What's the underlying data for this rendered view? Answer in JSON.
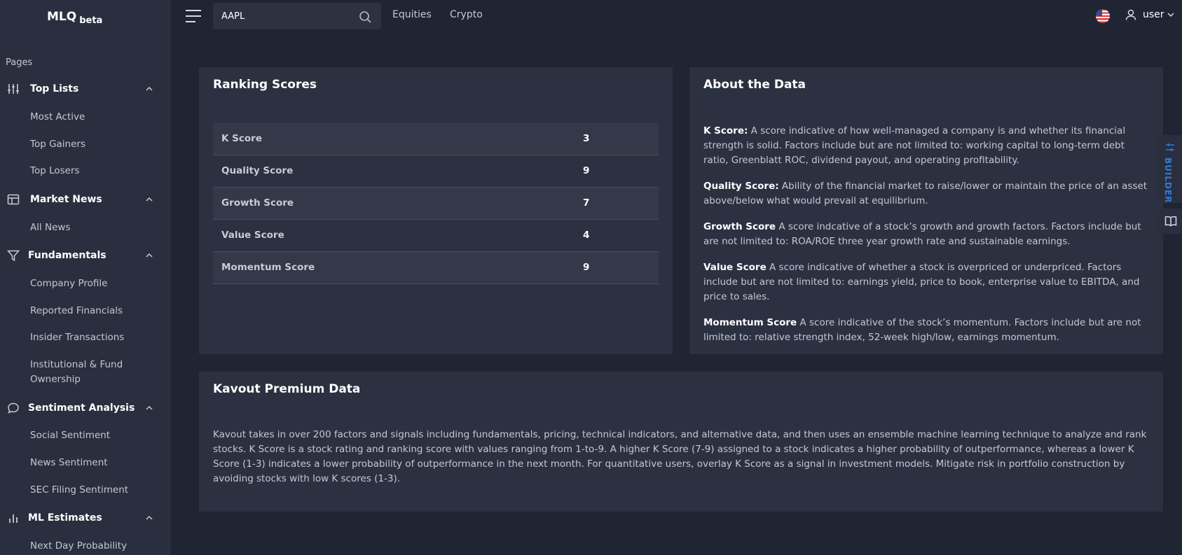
{
  "app": {
    "logo": "MLQ",
    "badge": "beta"
  },
  "sidebar": {
    "pages_label": "Pages",
    "sections": [
      {
        "label": "Top Lists",
        "icon": "sliders-icon",
        "items": [
          "Most Active",
          "Top Gainers",
          "Top Losers"
        ]
      },
      {
        "label": "Market News",
        "icon": "newspaper-icon",
        "items": [
          "All News"
        ]
      },
      {
        "label": "Fundamentals",
        "icon": "filter-icon",
        "items": [
          "Company Profile",
          "Reported Financials",
          "Insider Transactions",
          "Institutional & Fund",
          "Ownership"
        ]
      },
      {
        "label": "Sentiment Analysis",
        "icon": "chat-bubble-icon",
        "items": [
          "Social Sentiment",
          "News Sentiment",
          "SEC Filing Sentiment"
        ]
      },
      {
        "label": "ML Estimates",
        "icon": "bar-chart-icon",
        "items": [
          "Next Day Probability"
        ]
      }
    ]
  },
  "topbar": {
    "search_value": "AAPL",
    "links": [
      "Equities",
      "Crypto"
    ],
    "user_label": "user"
  },
  "ranking": {
    "title": "Ranking Scores",
    "rows": [
      {
        "name": "K Score",
        "value": "3"
      },
      {
        "name": "Quality Score",
        "value": "9"
      },
      {
        "name": "Growth Score",
        "value": "7"
      },
      {
        "name": "Value Score",
        "value": "4"
      },
      {
        "name": "Momentum Score",
        "value": "9"
      }
    ]
  },
  "about": {
    "title": "About the Data",
    "entries": [
      {
        "term": "K Score:",
        "text": " A score indicative of how well-managed a company is and whether its financial strength is solid. Factors include but are not limited to: working capital to long-term debt ratio, Greenblatt ROC, dividend payout, and operating profitability."
      },
      {
        "term": "Quality Score:",
        "text": " Ability of the financial market to raise/lower or maintain the price of an asset above/below what would prevail at equilibrium."
      },
      {
        "term": "Growth Score",
        "text": " A score indcative of a stock’s growth and growth factors. Factors include but are not limited to: ROA/ROE three year growth rate and sustainable earnings."
      },
      {
        "term": "Value Score",
        "text": " A score indicative of whether a stock is overpriced or underpriced. Factors include but are not limited to: earnings yield, price to book, enterprise value to EBITDA, and price to sales."
      },
      {
        "term": "Momentum Score",
        "text": " A score indicative of the stock’s momentum. Factors include but are not limited to: relative strength index, 52-week high/low, earnings momentum."
      }
    ]
  },
  "kavout": {
    "title": "Kavout Premium Data",
    "text": "Kavout takes in over 200 factors and signals including fundamentals, pricing, technical indicators, and alternative data, and then uses an ensemble machine learning technique to analyze and rank stocks. K Score is a stock rating and ranking score with values ranging from 1-to-9. A higher K Score (7-9) assigned to a stock indicates a higher probability of outperformance, whereas a lower K Score (1-3) indicates a lower probability of outperformance in the next month. For quantitative users, overlay K Score as a signal in investment models. Mitigate risk in portfolio construction by avoiding stocks with low K scores (1-3)."
  },
  "floating": {
    "builder_label": "BUILDER"
  }
}
